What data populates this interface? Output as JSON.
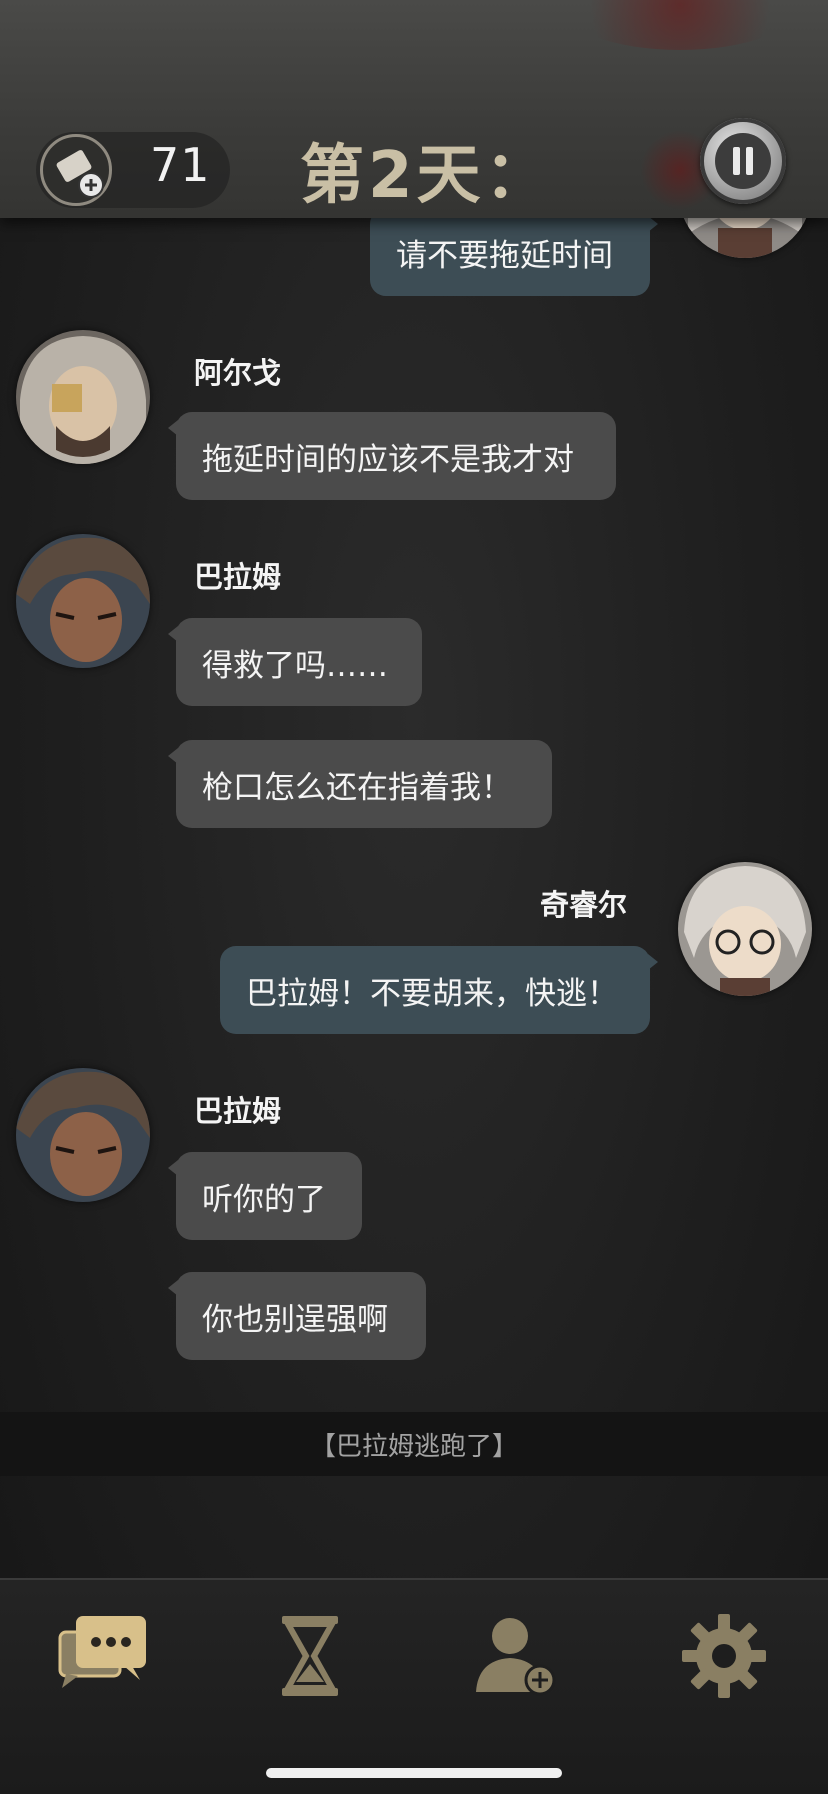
{
  "header": {
    "ticket_count": "71",
    "day_title": "第2天：",
    "icons": {
      "ticket": "ticket-plus-icon",
      "pause": "pause-icon"
    }
  },
  "messages": [
    {
      "side": "right",
      "sender": "",
      "text": "请不要拖延时间"
    },
    {
      "side": "left",
      "sender": "阿尔戈",
      "text": "拖延时间的应该不是我才对"
    },
    {
      "side": "left",
      "sender": "巴拉姆",
      "text": "得救了吗……"
    },
    {
      "side": "left",
      "sender": "",
      "text": "枪口怎么还在指着我！"
    },
    {
      "side": "right",
      "sender": "奇睿尔",
      "text": "巴拉姆！不要胡来，快逃！"
    },
    {
      "side": "left",
      "sender": "巴拉姆",
      "text": "听你的了"
    },
    {
      "side": "left",
      "sender": "",
      "text": "你也别逞强啊"
    }
  ],
  "event": "【巴拉姆逃跑了】",
  "bottom_nav": [
    {
      "icon": "chat-icon",
      "active": true
    },
    {
      "icon": "hourglass-icon",
      "active": false
    },
    {
      "icon": "add-friend-icon",
      "active": false
    },
    {
      "icon": "gear-icon",
      "active": false
    }
  ],
  "colors": {
    "accent_gold": "#d8c08a",
    "inactive_icon": "#8a7f63",
    "bubble_left": "#4b4b4b",
    "bubble_right": "#3d4d55"
  }
}
